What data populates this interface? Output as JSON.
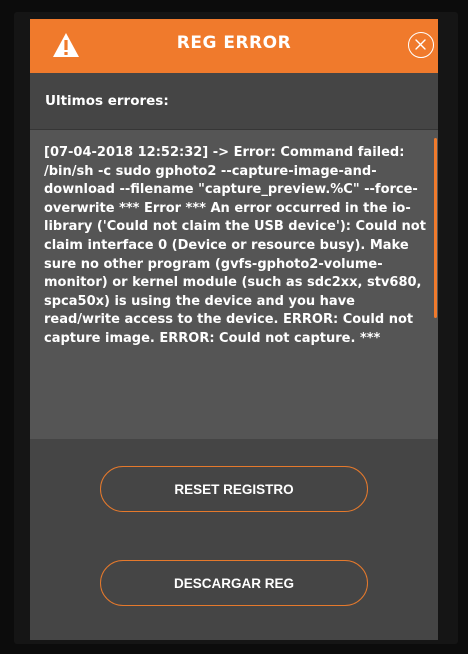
{
  "dialog": {
    "title": "REG ERROR",
    "section_label": "Ultimos errores:",
    "log_text": "[07-04-2018 12:52:32] -> Error: Command failed: /bin/sh -c sudo gphoto2 --capture-image-and-download --filename \"capture_preview.%C\" --force-overwrite *** Error *** An error occurred in the io-library ('Could not claim the USB device'): Could not claim interface 0 (Device or resource busy). Make sure no other program (gvfs-gphoto2-volume-monitor) or kernel module (such as sdc2xx, stv680, spca50x) is using the device and you have read/write access to the device. ERROR: Could not capture image. ERROR: Could not capture. ***",
    "buttons": {
      "reset_label": "RESET REGISTRO",
      "download_label": "DESCARGAR REG"
    }
  },
  "icons": {
    "header_left": "warning-triangle-icon",
    "header_right": "close-icon"
  },
  "colors": {
    "accent": "#f07a2c",
    "dialog_bg": "#454545",
    "log_bg": "#555555",
    "outer_bg": "#151515"
  }
}
